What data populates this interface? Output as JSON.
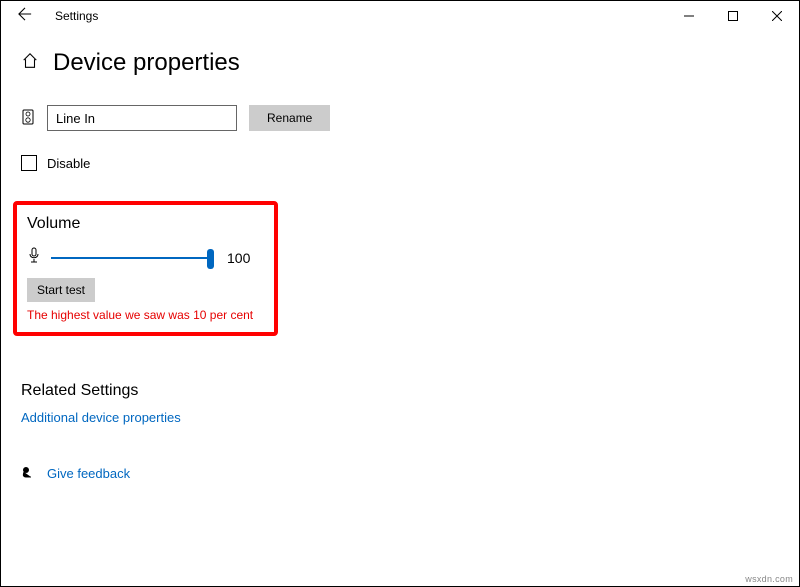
{
  "window": {
    "title": "Settings"
  },
  "page": {
    "title": "Device properties"
  },
  "device": {
    "name_value": "Line In",
    "rename_label": "Rename"
  },
  "disable": {
    "label": "Disable"
  },
  "volume": {
    "section_title": "Volume",
    "value": "100",
    "start_test_label": "Start test",
    "result_text": "The highest value we saw was 10 per cent"
  },
  "related": {
    "section_title": "Related Settings",
    "additional_link": "Additional device properties"
  },
  "feedback": {
    "label": "Give feedback"
  },
  "watermark": "wsxdn.com"
}
